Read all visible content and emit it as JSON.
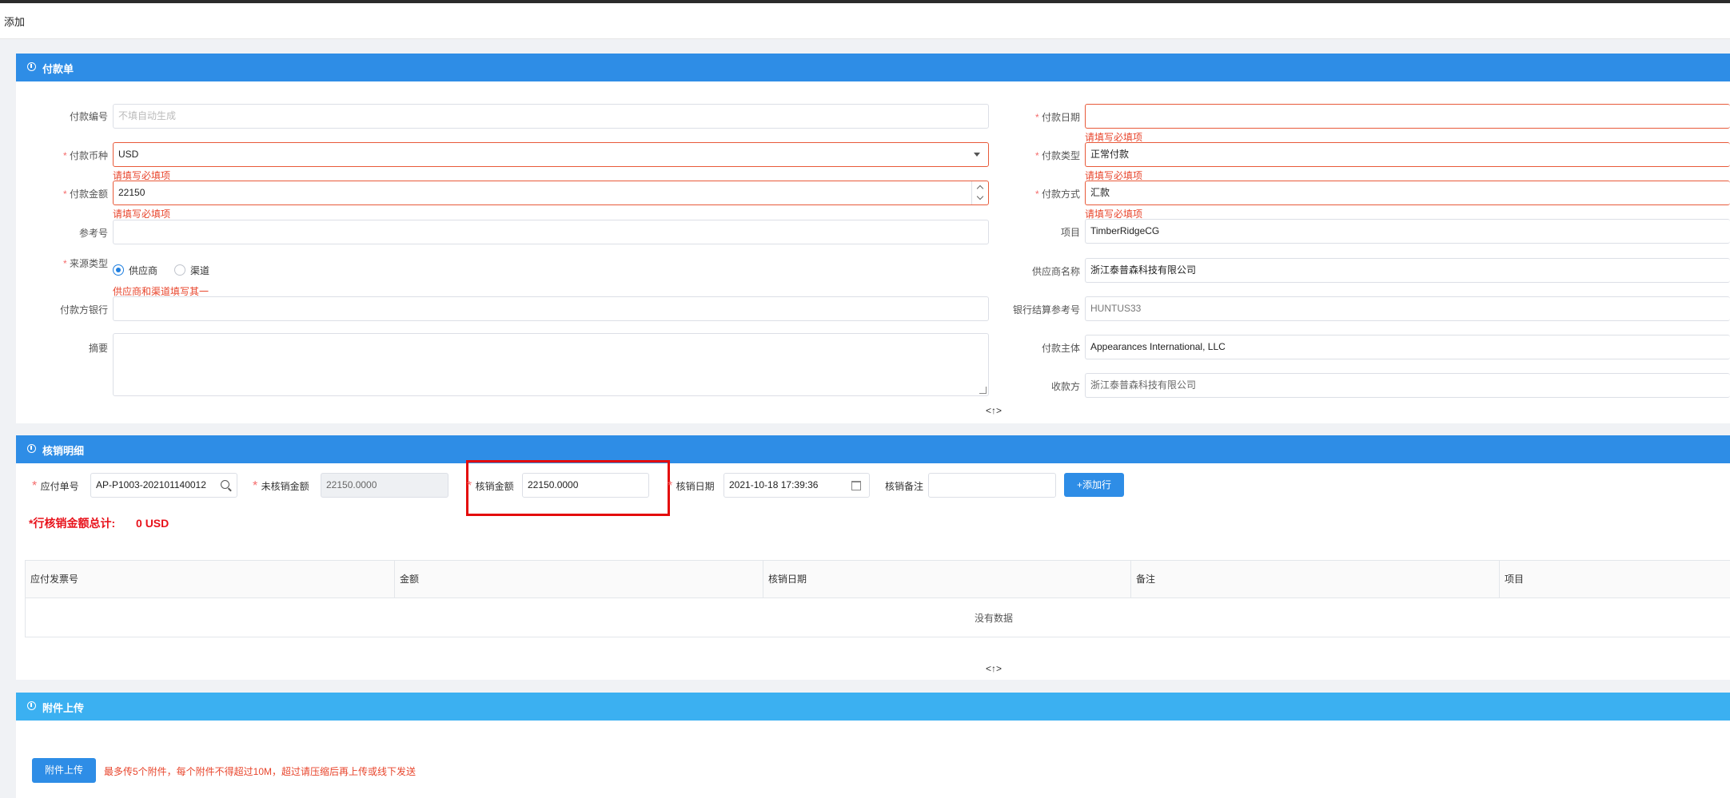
{
  "page": {
    "title": "添加"
  },
  "payment": {
    "header": "付款单",
    "fields": {
      "pay_no": {
        "label": "付款编号",
        "placeholder": "不填自动生成"
      },
      "currency": {
        "label": "付款币种",
        "value": "USD",
        "error": "请填写必填项"
      },
      "amount": {
        "label": "付款金额",
        "value": "22150",
        "error": "请填写必填项"
      },
      "ref_no": {
        "label": "参考号",
        "value": ""
      },
      "source_type": {
        "label": "来源类型",
        "options": [
          "供应商",
          "渠道"
        ],
        "selected": "供应商",
        "error": "供应商和渠道填写其一"
      },
      "payer_bank": {
        "label": "付款方银行",
        "value": ""
      },
      "summary": {
        "label": "摘要",
        "value": ""
      },
      "pay_date": {
        "label": "付款日期",
        "value": "",
        "error": "请填写必填项"
      },
      "pay_type": {
        "label": "付款类型",
        "value": "正常付款",
        "error": "请填写必填项"
      },
      "pay_method": {
        "label": "付款方式",
        "value": "汇款",
        "error": "请填写必填项"
      },
      "project": {
        "label": "项目",
        "value": "TimberRidgeCG"
      },
      "supplier_name": {
        "label": "供应商名称",
        "value": "浙江泰普森科技有限公司"
      },
      "bank_ref": {
        "label": "银行结算参考号",
        "value": "HUNTUS33"
      },
      "pay_entity": {
        "label": "付款主体",
        "value": "Appearances International, LLC"
      },
      "payee": {
        "label": "收款方",
        "value": "浙江泰普森科技有限公司"
      }
    }
  },
  "writeoff": {
    "header": "核销明细",
    "payable_no": {
      "label": "应付单号",
      "value": "AP-P1003-202101140012"
    },
    "unwritten_amount": {
      "label": "未核销金额",
      "value": "22150.0000"
    },
    "writeoff_amount": {
      "label": "核销金额",
      "value": "22150.0000"
    },
    "writeoff_date": {
      "label": "核销日期",
      "value": "2021-10-18 17:39:36"
    },
    "writeoff_note": {
      "label": "核销备注",
      "value": ""
    },
    "add_row_label": "+添加行",
    "total_label": "行核销金额总计:",
    "total_value": "0 USD",
    "table": {
      "columns": [
        "应付发票号",
        "金额",
        "核销日期",
        "备注",
        "项目"
      ],
      "empty_text": "没有数据"
    }
  },
  "attachment": {
    "header": "附件上传",
    "upload_label": "附件上传",
    "hint": "最多传5个附件，每个附件不得超过10M，超过请压缩后再上传或线下发送"
  },
  "collapse_glyph": "<↑>"
}
